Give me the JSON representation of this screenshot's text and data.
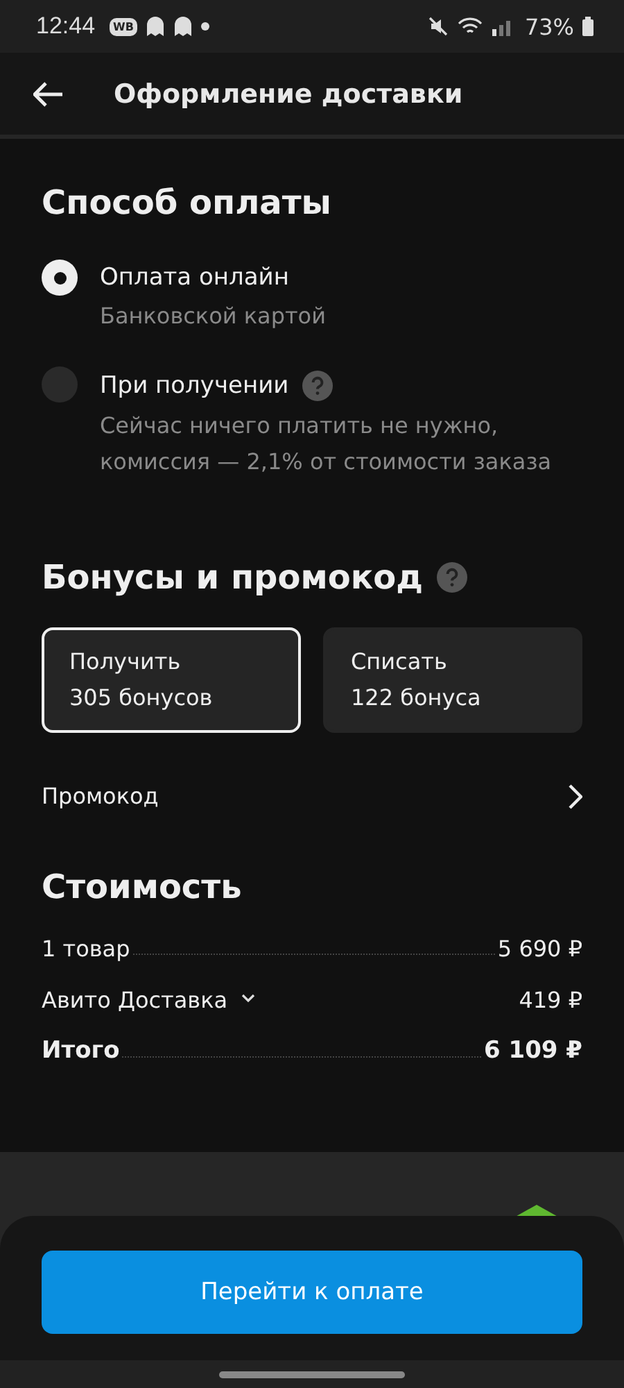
{
  "status_bar": {
    "time": "12:44",
    "app_badge": "WB",
    "battery": "73%"
  },
  "header": {
    "title": "Оформление доставки"
  },
  "payment": {
    "title": "Способ оплаты",
    "options": [
      {
        "label": "Оплата онлайн",
        "hint": "Банковской картой",
        "selected": true,
        "help": false
      },
      {
        "label": "При получении",
        "hint": "Сейчас ничего платить не нужно, комиссия — 2,1% от стоимости заказа",
        "selected": false,
        "help": true
      }
    ]
  },
  "bonuses": {
    "title": "Бонусы и промокод",
    "cards": [
      {
        "action": "Получить",
        "amount": "305 бонусов",
        "selected": true
      },
      {
        "action": "Списать",
        "amount": "122 бонуса",
        "selected": false
      }
    ],
    "promo": "Промокод"
  },
  "cost": {
    "title": "Стоимость",
    "rows": [
      {
        "kind": "dotted",
        "label": "1 товар",
        "value": "5 690 ₽",
        "bold": false
      },
      {
        "kind": "expandable",
        "label": "Авито Доставка",
        "value": "419 ₽",
        "bold": false
      },
      {
        "kind": "dotted",
        "label": "Итого",
        "value": "6 109 ₽",
        "bold": true
      }
    ]
  },
  "pay_button": "Перейти к оплате"
}
